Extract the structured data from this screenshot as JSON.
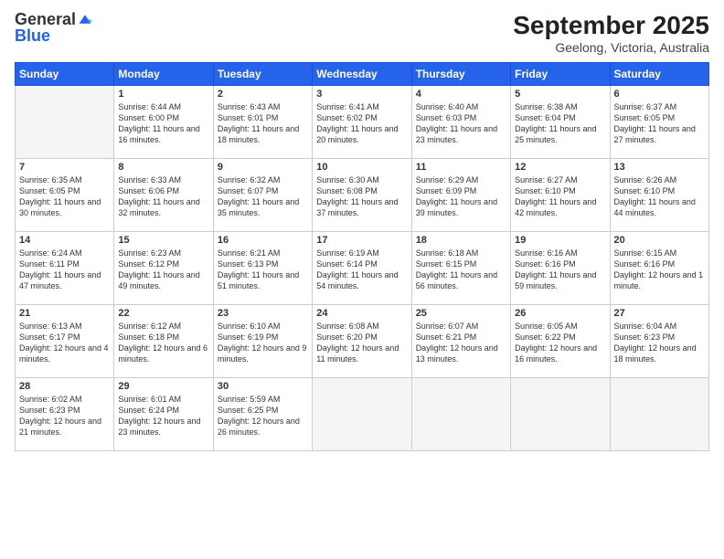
{
  "logo": {
    "general": "General",
    "blue": "Blue"
  },
  "header": {
    "month": "September 2025",
    "location": "Geelong, Victoria, Australia"
  },
  "days_of_week": [
    "Sunday",
    "Monday",
    "Tuesday",
    "Wednesday",
    "Thursday",
    "Friday",
    "Saturday"
  ],
  "weeks": [
    [
      {
        "day": "",
        "detail": ""
      },
      {
        "day": "1",
        "detail": "Sunrise: 6:44 AM\nSunset: 6:00 PM\nDaylight: 11 hours\nand 16 minutes."
      },
      {
        "day": "2",
        "detail": "Sunrise: 6:43 AM\nSunset: 6:01 PM\nDaylight: 11 hours\nand 18 minutes."
      },
      {
        "day": "3",
        "detail": "Sunrise: 6:41 AM\nSunset: 6:02 PM\nDaylight: 11 hours\nand 20 minutes."
      },
      {
        "day": "4",
        "detail": "Sunrise: 6:40 AM\nSunset: 6:03 PM\nDaylight: 11 hours\nand 23 minutes."
      },
      {
        "day": "5",
        "detail": "Sunrise: 6:38 AM\nSunset: 6:04 PM\nDaylight: 11 hours\nand 25 minutes."
      },
      {
        "day": "6",
        "detail": "Sunrise: 6:37 AM\nSunset: 6:05 PM\nDaylight: 11 hours\nand 27 minutes."
      }
    ],
    [
      {
        "day": "7",
        "detail": "Sunrise: 6:35 AM\nSunset: 6:05 PM\nDaylight: 11 hours\nand 30 minutes."
      },
      {
        "day": "8",
        "detail": "Sunrise: 6:33 AM\nSunset: 6:06 PM\nDaylight: 11 hours\nand 32 minutes."
      },
      {
        "day": "9",
        "detail": "Sunrise: 6:32 AM\nSunset: 6:07 PM\nDaylight: 11 hours\nand 35 minutes."
      },
      {
        "day": "10",
        "detail": "Sunrise: 6:30 AM\nSunset: 6:08 PM\nDaylight: 11 hours\nand 37 minutes."
      },
      {
        "day": "11",
        "detail": "Sunrise: 6:29 AM\nSunset: 6:09 PM\nDaylight: 11 hours\nand 39 minutes."
      },
      {
        "day": "12",
        "detail": "Sunrise: 6:27 AM\nSunset: 6:10 PM\nDaylight: 11 hours\nand 42 minutes."
      },
      {
        "day": "13",
        "detail": "Sunrise: 6:26 AM\nSunset: 6:10 PM\nDaylight: 11 hours\nand 44 minutes."
      }
    ],
    [
      {
        "day": "14",
        "detail": "Sunrise: 6:24 AM\nSunset: 6:11 PM\nDaylight: 11 hours\nand 47 minutes."
      },
      {
        "day": "15",
        "detail": "Sunrise: 6:23 AM\nSunset: 6:12 PM\nDaylight: 11 hours\nand 49 minutes."
      },
      {
        "day": "16",
        "detail": "Sunrise: 6:21 AM\nSunset: 6:13 PM\nDaylight: 11 hours\nand 51 minutes."
      },
      {
        "day": "17",
        "detail": "Sunrise: 6:19 AM\nSunset: 6:14 PM\nDaylight: 11 hours\nand 54 minutes."
      },
      {
        "day": "18",
        "detail": "Sunrise: 6:18 AM\nSunset: 6:15 PM\nDaylight: 11 hours\nand 56 minutes."
      },
      {
        "day": "19",
        "detail": "Sunrise: 6:16 AM\nSunset: 6:16 PM\nDaylight: 11 hours\nand 59 minutes."
      },
      {
        "day": "20",
        "detail": "Sunrise: 6:15 AM\nSunset: 6:16 PM\nDaylight: 12 hours\nand 1 minute."
      }
    ],
    [
      {
        "day": "21",
        "detail": "Sunrise: 6:13 AM\nSunset: 6:17 PM\nDaylight: 12 hours\nand 4 minutes."
      },
      {
        "day": "22",
        "detail": "Sunrise: 6:12 AM\nSunset: 6:18 PM\nDaylight: 12 hours\nand 6 minutes."
      },
      {
        "day": "23",
        "detail": "Sunrise: 6:10 AM\nSunset: 6:19 PM\nDaylight: 12 hours\nand 9 minutes."
      },
      {
        "day": "24",
        "detail": "Sunrise: 6:08 AM\nSunset: 6:20 PM\nDaylight: 12 hours\nand 11 minutes."
      },
      {
        "day": "25",
        "detail": "Sunrise: 6:07 AM\nSunset: 6:21 PM\nDaylight: 12 hours\nand 13 minutes."
      },
      {
        "day": "26",
        "detail": "Sunrise: 6:05 AM\nSunset: 6:22 PM\nDaylight: 12 hours\nand 16 minutes."
      },
      {
        "day": "27",
        "detail": "Sunrise: 6:04 AM\nSunset: 6:23 PM\nDaylight: 12 hours\nand 18 minutes."
      }
    ],
    [
      {
        "day": "28",
        "detail": "Sunrise: 6:02 AM\nSunset: 6:23 PM\nDaylight: 12 hours\nand 21 minutes."
      },
      {
        "day": "29",
        "detail": "Sunrise: 6:01 AM\nSunset: 6:24 PM\nDaylight: 12 hours\nand 23 minutes."
      },
      {
        "day": "30",
        "detail": "Sunrise: 5:59 AM\nSunset: 6:25 PM\nDaylight: 12 hours\nand 26 minutes."
      },
      {
        "day": "",
        "detail": ""
      },
      {
        "day": "",
        "detail": ""
      },
      {
        "day": "",
        "detail": ""
      },
      {
        "day": "",
        "detail": ""
      }
    ]
  ]
}
